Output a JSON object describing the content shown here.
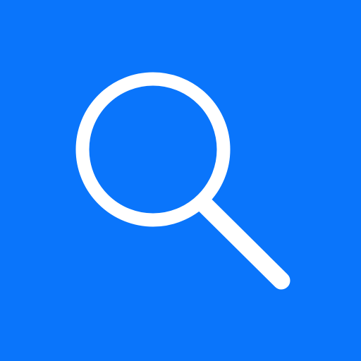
{
  "icon": {
    "name": "search-icon",
    "background_color": "#0A75FB",
    "glyph_color": "#FFFFFF"
  }
}
